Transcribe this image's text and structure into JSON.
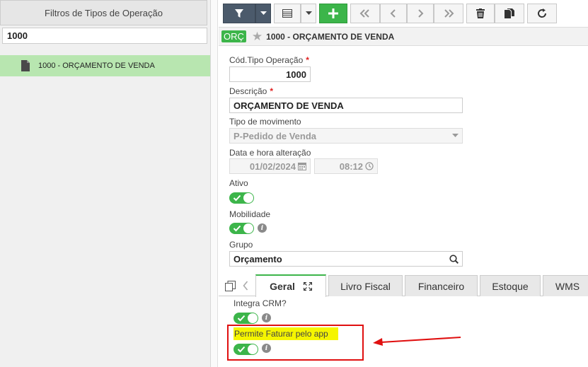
{
  "left_panel": {
    "header": "Filtros de Tipos de Operação",
    "search_value": "1000",
    "items": [
      {
        "label": "1000 - ORÇAMENTO DE VENDA"
      }
    ]
  },
  "toolbar": {
    "buttons": [
      "filter-icon",
      "chevron-down-icon",
      "list-icon",
      "chevron-down-icon",
      "plus-icon",
      "first-icon",
      "prev-icon",
      "next-icon",
      "last-icon",
      "trash-icon",
      "copy-icon",
      "refresh-icon"
    ]
  },
  "record": {
    "badge": "ORÇ",
    "title": "1000 - ORÇAMENTO DE VENDA"
  },
  "form": {
    "cod_label": "Cód.Tipo Operação",
    "cod_value": "1000",
    "descricao_label": "Descrição",
    "descricao_value": "ORÇAMENTO DE VENDA",
    "tipo_mov_label": "Tipo de movimento",
    "tipo_mov_value": "P-Pedido de Venda",
    "data_label": "Data e hora alteração",
    "data_value": "01/02/2024",
    "hora_value": "08:12",
    "ativo_label": "Ativo",
    "ativo_on": true,
    "mobilidade_label": "Mobilidade",
    "mobilidade_on": true,
    "grupo_label": "Grupo",
    "grupo_value": "Orçamento",
    "required_mark": "*"
  },
  "tabs": [
    {
      "label": "Geral",
      "active": true
    },
    {
      "label": "Livro Fiscal"
    },
    {
      "label": "Financeiro"
    },
    {
      "label": "Estoque"
    },
    {
      "label": "WMS"
    }
  ],
  "geral": {
    "integra_crm_label": "Integra CRM?",
    "integra_crm_on": true,
    "permite_faturar_label": "Permite Faturar pelo app",
    "permite_faturar_on": true
  },
  "colors": {
    "accent_green": "#3cb54a",
    "toolbar_dark": "#4b5a6b",
    "selected_row": "#b8e6b0",
    "highlight_yellow": "#f5f500",
    "annotation_red": "#e01010"
  }
}
